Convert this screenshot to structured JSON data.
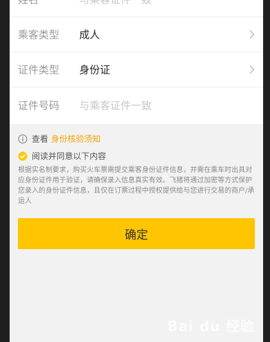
{
  "form": {
    "name": {
      "label": "姓名",
      "placeholder": "与乘客证件一致"
    },
    "passenger_type": {
      "label": "乘客类型",
      "value": "成人"
    },
    "id_type": {
      "label": "证件类型",
      "value": "身份证"
    },
    "id_number": {
      "label": "证件号码",
      "placeholder": "与乘客证件一致"
    }
  },
  "notice": {
    "prefix": "查看",
    "link": "身份核验须知"
  },
  "agree": {
    "label": "阅读并同意以下内容"
  },
  "description": "根据实名制要求，购买火车票需提交乘客身份证件信息，并需在乘车时出具对应身份证件用于验证，请确保录入信息真实有效。飞猪将通过加密等方式保护您录入的身份证件信息，且仅在订票过程中授权提供给与您进行交易的商户/承运人",
  "confirm_button": "确定",
  "watermark": "Bai du 经验",
  "colors": {
    "accent": "#ffc600",
    "link": "#f5a200"
  }
}
